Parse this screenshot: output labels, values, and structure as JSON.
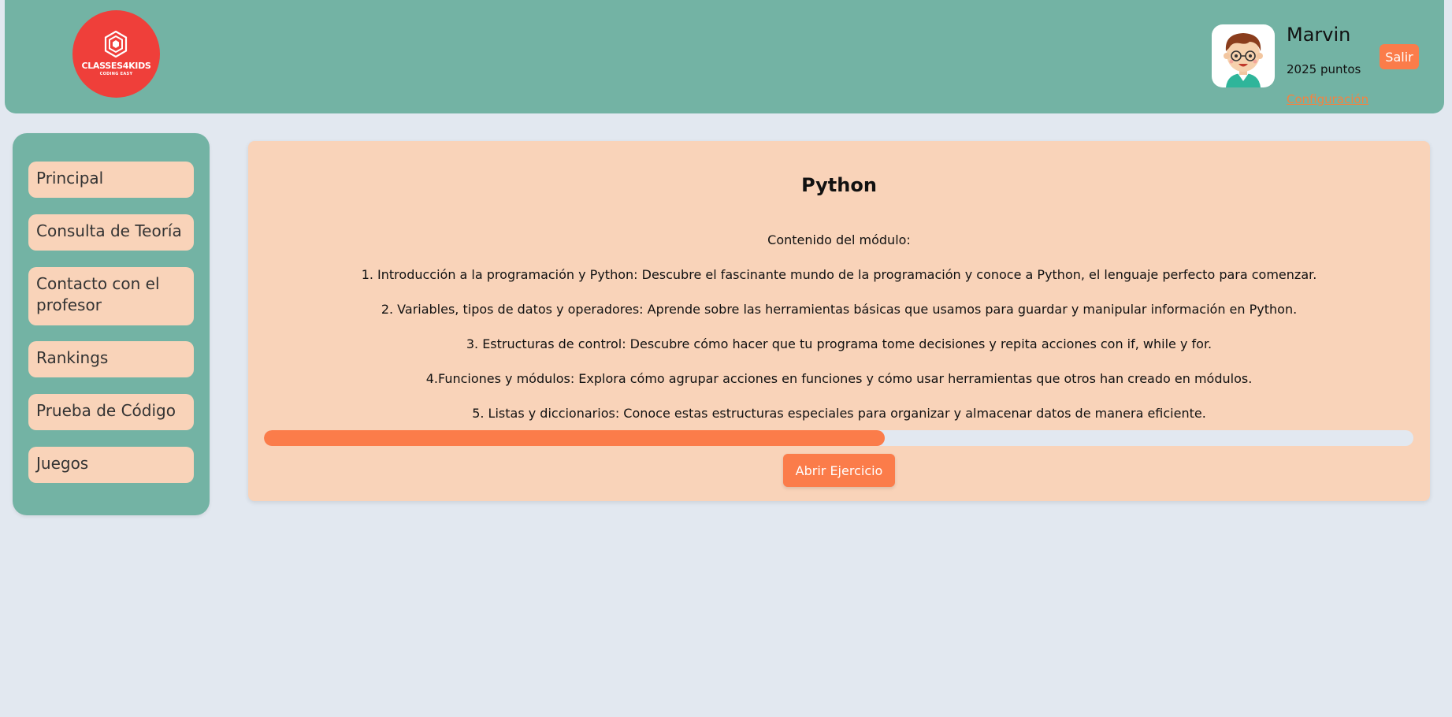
{
  "header": {
    "logo": {
      "name": "CLASSES4KIDS",
      "tagline": "CODING EASY",
      "icon": "hexagon-logo-icon",
      "color": "#ef3f3a"
    },
    "user": {
      "avatar_icon": "boy-avatar-icon",
      "name": "Marvin",
      "points": "2025 puntos",
      "config_label": "Configuración"
    },
    "logout_label": "Salir"
  },
  "sidebar": {
    "items": [
      {
        "label": "Principal"
      },
      {
        "label": "Consulta de Teoría"
      },
      {
        "label": "Contacto con el profesor"
      },
      {
        "label": "Rankings"
      },
      {
        "label": "Prueba de Código"
      },
      {
        "label": "Juegos"
      }
    ]
  },
  "module": {
    "title": "Python",
    "contents_heading": "Contenido del módulo:",
    "items": [
      "1. Introducción a la programación y Python: Descubre el fascinante mundo de la programación y conoce a Python, el lenguaje perfecto para comenzar.",
      "2. Variables, tipos de datos y operadores: Aprende sobre las herramientas básicas que usamos para guardar y manipular información en Python.",
      "3. Estructuras de control: Descubre cómo hacer que tu programa tome decisiones y repita acciones con if, while y for.",
      "4.Funciones y módulos: Explora cómo agrupar acciones en funciones y cómo usar herramientas que otros han creado en módulos.",
      "5. Listas y diccionarios: Conoce estas estructuras especiales para organizar y almacenar datos de manera eficiente."
    ],
    "progress": 0.54,
    "exercise_button_label": "Abrir Ejercicio"
  },
  "colors": {
    "header_bg": "#73b3a4",
    "panel_bg": "#f9d3b9",
    "accent": "#fb7c4a",
    "page_bg": "#e2e8f0"
  }
}
